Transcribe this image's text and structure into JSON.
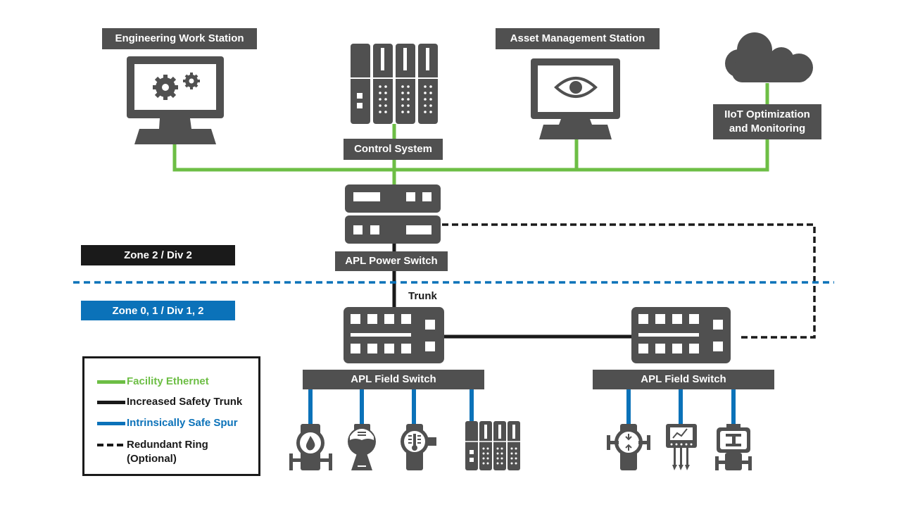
{
  "colors": {
    "facility_ethernet": "#6dbe45",
    "trunk": "#1a1a1a",
    "spur": "#0b72b9",
    "device": "#505050",
    "zone2_bg": "#1a1a1a",
    "zone01_bg": "#0b72b9"
  },
  "nodes": {
    "engineering": {
      "label": "Engineering Work Station",
      "icon": "gears-monitor-icon"
    },
    "control": {
      "label": "Control System",
      "icon": "controller-rack-icon"
    },
    "asset": {
      "label": "Asset Management Station",
      "icon": "eye-monitor-icon"
    },
    "iiot": {
      "label_line1": "IIoT Optimization",
      "label_line2": "and Monitoring",
      "icon": "cloud-icon"
    },
    "power_switch": {
      "label": "APL Power Switch",
      "icon": "power-switch-icon"
    },
    "field_switch_1": {
      "label": "APL Field Switch",
      "icon": "field-switch-icon"
    },
    "field_switch_2": {
      "label": "APL Field Switch",
      "icon": "field-switch-icon"
    }
  },
  "zones": {
    "zone2": "Zone 2 / Div 2",
    "zone01": "Zone 0, 1 / Div 1, 2"
  },
  "trunk_label": "Trunk",
  "field_devices_1": [
    "flow-meter-icon",
    "level-sensor-icon",
    "temperature-transmitter-icon",
    "io-module-icon"
  ],
  "field_devices_2": [
    "pressure-transmitter-icon",
    "analyzer-icon",
    "valve-actuator-icon"
  ],
  "legend": {
    "facility_ethernet": "Facility Ethernet",
    "trunk": "Increased Safety Trunk",
    "spur": "Intrinsically Safe Spur",
    "ring_line1": "Redundant Ring",
    "ring_line2": "(Optional)"
  }
}
